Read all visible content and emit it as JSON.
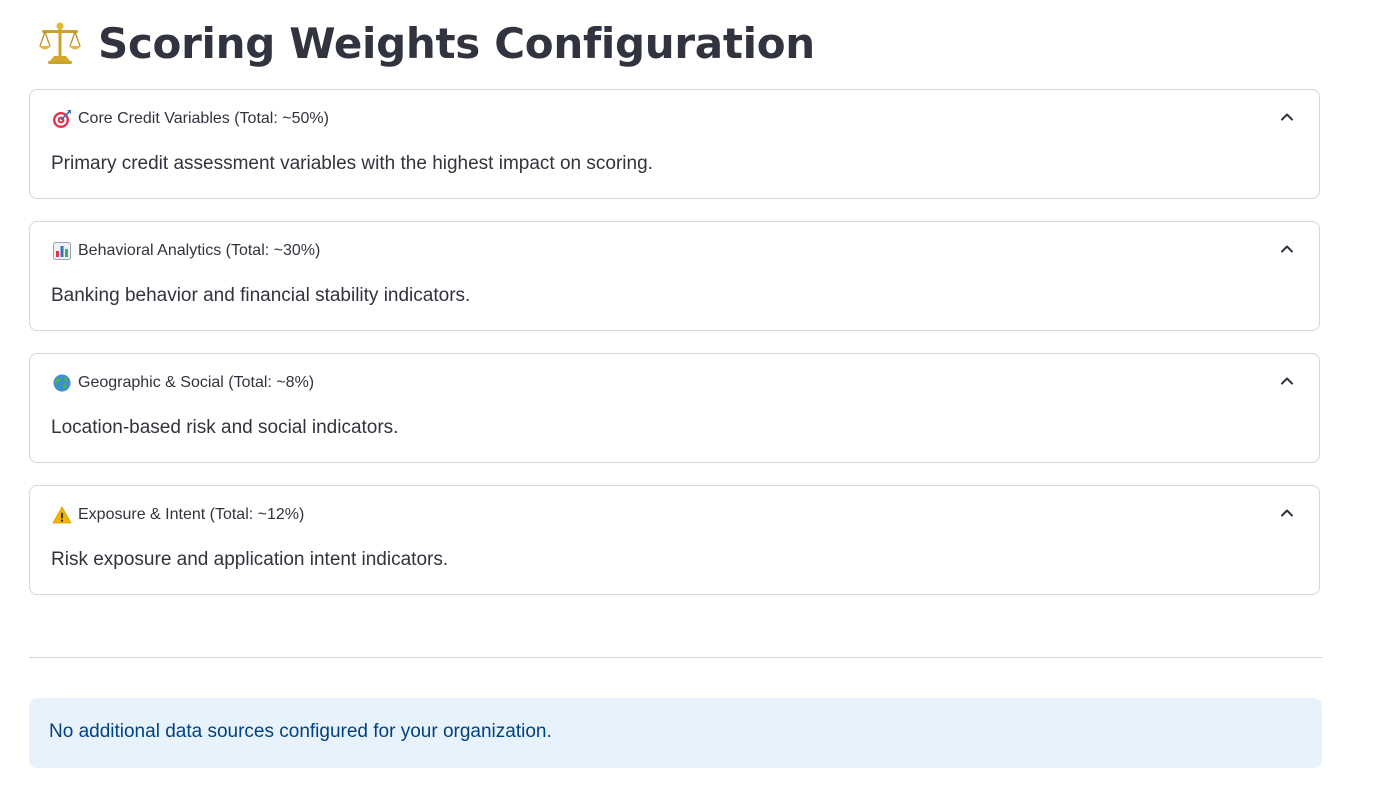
{
  "page": {
    "title": "Scoring Weights Configuration",
    "title_icon": "balance-scale-icon"
  },
  "sections": [
    {
      "icon": "target-icon",
      "label": "Core Credit Variables (Total: ~50%)",
      "description": "Primary credit assessment variables with the highest impact on scoring.",
      "expanded": true
    },
    {
      "icon": "bar-chart-icon",
      "label": "Behavioral Analytics (Total: ~30%)",
      "description": "Banking behavior and financial stability indicators.",
      "expanded": true
    },
    {
      "icon": "globe-icon",
      "label": "Geographic & Social (Total: ~8%)",
      "description": "Location-based risk and social indicators.",
      "expanded": true
    },
    {
      "icon": "warning-icon",
      "label": "Exposure & Intent (Total: ~12%)",
      "description": "Risk exposure and application intent indicators.",
      "expanded": true
    }
  ],
  "info": {
    "message": "No additional data sources configured for your organization."
  },
  "colors": {
    "text": "#31333f",
    "border": "#d6d6d9",
    "info_background": "#e8f2fc",
    "info_text": "#004280"
  }
}
